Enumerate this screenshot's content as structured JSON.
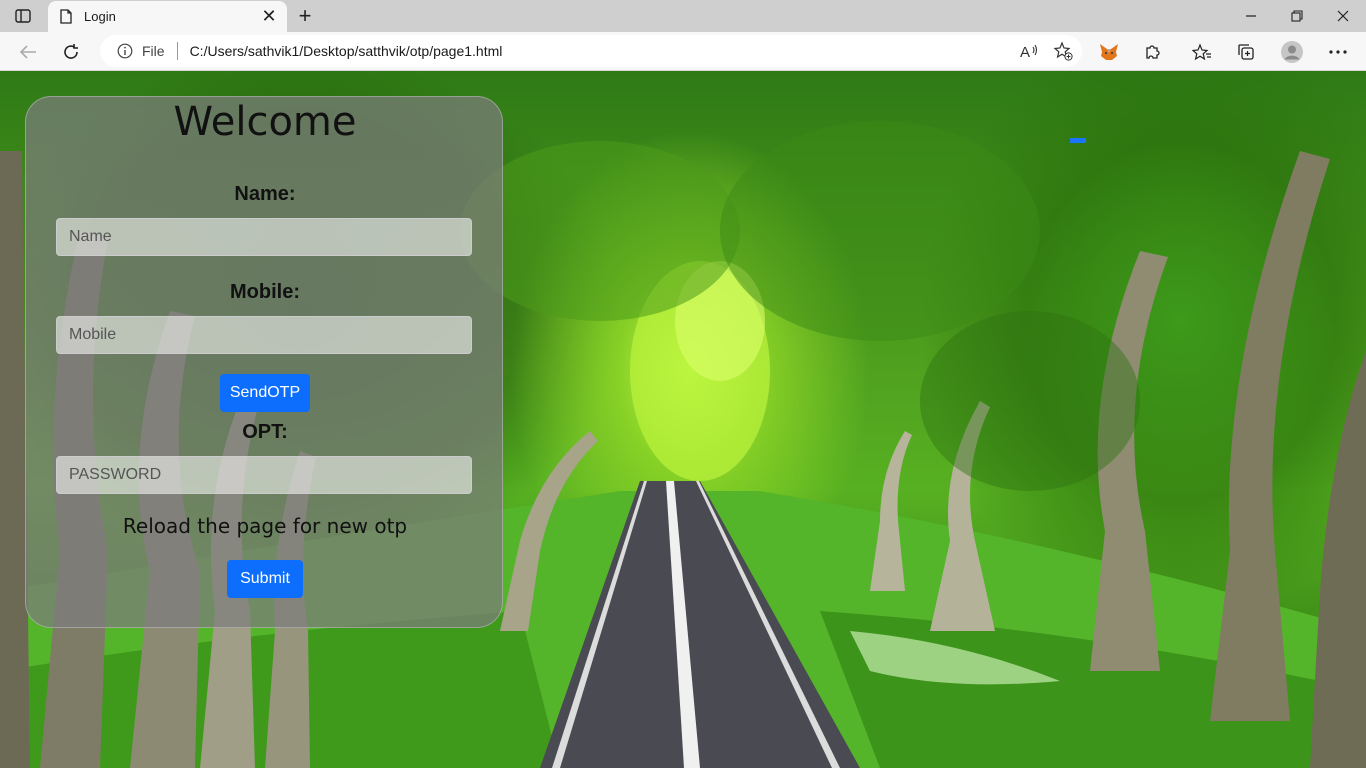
{
  "browser": {
    "tab_title": "Login",
    "address_scheme_label": "File",
    "url": "C:/Users/sathvik1/Desktop/satthvik/otp/page1.html",
    "icons": {
      "tab_actions": "tab-actions-icon",
      "favicon": "page-icon",
      "close_tab": "close-icon",
      "new_tab": "plus-icon",
      "back": "back-arrow-icon",
      "reload": "reload-icon",
      "site_info": "info-icon",
      "read_aloud": "read-aloud-icon",
      "add_favorite": "star-plus-icon",
      "extension_fox": "fox-extension-icon",
      "extensions": "puzzle-icon",
      "favorites": "favorites-icon",
      "collections": "collections-icon",
      "profile": "profile-avatar-icon",
      "menu": "more-icon",
      "minimize": "minimize-icon",
      "restore": "restore-icon",
      "close_window": "close-window-icon"
    },
    "new_tab_symbol": "+",
    "close_symbol": "✕"
  },
  "form": {
    "heading": "Welcome",
    "name_label": "Name:",
    "name_placeholder": "Name",
    "mobile_label": "Mobile:",
    "mobile_placeholder": "Mobile",
    "send_otp_label": "SendOTP",
    "otp_label": "OPT:",
    "otp_placeholder": "PASSWORD",
    "reload_note": "Reload the page for new otp",
    "submit_label": "Submit"
  },
  "colors": {
    "primary_button": "#0d6efd",
    "card_overlay": "rgba(125,125,125,0.72)",
    "foliage": "#3f8f18"
  }
}
